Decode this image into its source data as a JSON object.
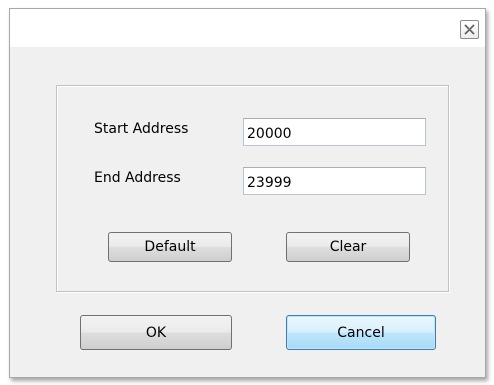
{
  "dialog": {
    "close_icon": "close-icon",
    "group": {
      "start_address": {
        "label": "Start Address",
        "value": "20000"
      },
      "end_address": {
        "label": "End Address",
        "value": "23999"
      },
      "default_label": "Default",
      "clear_label": "Clear"
    },
    "ok_label": "OK",
    "cancel_label": "Cancel"
  }
}
